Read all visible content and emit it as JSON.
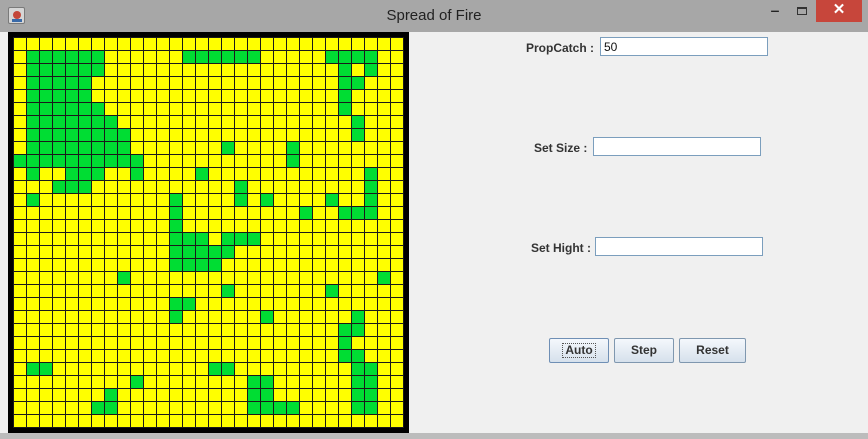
{
  "window": {
    "title": "Spread of Fire"
  },
  "titlebar": {
    "minimize_icon": "minimize-icon",
    "maximize_icon": "maximize-icon",
    "close_icon": "close-icon",
    "close_color": "#c7463b"
  },
  "grid": {
    "rows": 30,
    "cols": 30,
    "tree_color": "#ffff00",
    "burnt_color": "#00dd33",
    "line_color": "#1a1a1a",
    "frame_color": "#000000",
    "burnt_cells": [
      [
        1,
        1
      ],
      [
        1,
        2
      ],
      [
        1,
        3
      ],
      [
        1,
        4
      ],
      [
        1,
        5
      ],
      [
        1,
        6
      ],
      [
        1,
        13
      ],
      [
        1,
        14
      ],
      [
        1,
        15
      ],
      [
        1,
        16
      ],
      [
        1,
        17
      ],
      [
        1,
        18
      ],
      [
        1,
        24
      ],
      [
        1,
        25
      ],
      [
        1,
        26
      ],
      [
        1,
        27
      ],
      [
        2,
        1
      ],
      [
        2,
        2
      ],
      [
        2,
        3
      ],
      [
        2,
        4
      ],
      [
        2,
        5
      ],
      [
        2,
        6
      ],
      [
        2,
        25
      ],
      [
        2,
        27
      ],
      [
        3,
        1
      ],
      [
        3,
        2
      ],
      [
        3,
        3
      ],
      [
        3,
        4
      ],
      [
        3,
        5
      ],
      [
        3,
        25
      ],
      [
        3,
        26
      ],
      [
        4,
        1
      ],
      [
        4,
        2
      ],
      [
        4,
        3
      ],
      [
        4,
        4
      ],
      [
        4,
        5
      ],
      [
        4,
        25
      ],
      [
        5,
        1
      ],
      [
        5,
        2
      ],
      [
        5,
        3
      ],
      [
        5,
        4
      ],
      [
        5,
        5
      ],
      [
        5,
        6
      ],
      [
        5,
        25
      ],
      [
        6,
        1
      ],
      [
        6,
        2
      ],
      [
        6,
        3
      ],
      [
        6,
        4
      ],
      [
        6,
        5
      ],
      [
        6,
        6
      ],
      [
        6,
        7
      ],
      [
        6,
        26
      ],
      [
        7,
        1
      ],
      [
        7,
        2
      ],
      [
        7,
        3
      ],
      [
        7,
        4
      ],
      [
        7,
        5
      ],
      [
        7,
        6
      ],
      [
        7,
        7
      ],
      [
        7,
        8
      ],
      [
        7,
        26
      ],
      [
        8,
        1
      ],
      [
        8,
        2
      ],
      [
        8,
        3
      ],
      [
        8,
        4
      ],
      [
        8,
        5
      ],
      [
        8,
        6
      ],
      [
        8,
        7
      ],
      [
        8,
        8
      ],
      [
        8,
        16
      ],
      [
        8,
        21
      ],
      [
        9,
        0
      ],
      [
        9,
        1
      ],
      [
        9,
        2
      ],
      [
        9,
        3
      ],
      [
        9,
        4
      ],
      [
        9,
        5
      ],
      [
        9,
        6
      ],
      [
        9,
        7
      ],
      [
        9,
        8
      ],
      [
        9,
        9
      ],
      [
        9,
        21
      ],
      [
        10,
        1
      ],
      [
        10,
        4
      ],
      [
        10,
        5
      ],
      [
        10,
        6
      ],
      [
        10,
        9
      ],
      [
        10,
        14
      ],
      [
        10,
        27
      ],
      [
        11,
        3
      ],
      [
        11,
        4
      ],
      [
        11,
        5
      ],
      [
        11,
        17
      ],
      [
        11,
        27
      ],
      [
        12,
        1
      ],
      [
        12,
        12
      ],
      [
        12,
        17
      ],
      [
        12,
        19
      ],
      [
        12,
        24
      ],
      [
        12,
        27
      ],
      [
        13,
        12
      ],
      [
        13,
        22
      ],
      [
        13,
        25
      ],
      [
        13,
        26
      ],
      [
        13,
        27
      ],
      [
        14,
        12
      ],
      [
        15,
        12
      ],
      [
        15,
        13
      ],
      [
        15,
        14
      ],
      [
        15,
        16
      ],
      [
        15,
        17
      ],
      [
        15,
        18
      ],
      [
        16,
        12
      ],
      [
        16,
        13
      ],
      [
        16,
        14
      ],
      [
        16,
        15
      ],
      [
        16,
        16
      ],
      [
        17,
        12
      ],
      [
        17,
        13
      ],
      [
        17,
        14
      ],
      [
        17,
        15
      ],
      [
        18,
        8
      ],
      [
        18,
        28
      ],
      [
        19,
        16
      ],
      [
        19,
        24
      ],
      [
        20,
        12
      ],
      [
        20,
        13
      ],
      [
        21,
        12
      ],
      [
        21,
        19
      ],
      [
        21,
        26
      ],
      [
        22,
        25
      ],
      [
        22,
        26
      ],
      [
        23,
        25
      ],
      [
        24,
        25
      ],
      [
        24,
        26
      ],
      [
        25,
        1
      ],
      [
        25,
        2
      ],
      [
        25,
        15
      ],
      [
        25,
        16
      ],
      [
        25,
        26
      ],
      [
        25,
        27
      ],
      [
        26,
        9
      ],
      [
        26,
        18
      ],
      [
        26,
        19
      ],
      [
        26,
        26
      ],
      [
        26,
        27
      ],
      [
        27,
        7
      ],
      [
        27,
        18
      ],
      [
        27,
        19
      ],
      [
        27,
        26
      ],
      [
        27,
        27
      ],
      [
        28,
        6
      ],
      [
        28,
        7
      ],
      [
        28,
        18
      ],
      [
        28,
        19
      ],
      [
        28,
        20
      ],
      [
        28,
        21
      ],
      [
        28,
        26
      ],
      [
        28,
        27
      ]
    ]
  },
  "form": {
    "propcatch_label": "PropCatch :",
    "propcatch_value": "50",
    "size_label": "Set Size :",
    "size_value": "",
    "hight_label": "Set Hight :",
    "hight_value": ""
  },
  "buttons": {
    "auto": "Auto",
    "step": "Step",
    "reset": "Reset"
  }
}
